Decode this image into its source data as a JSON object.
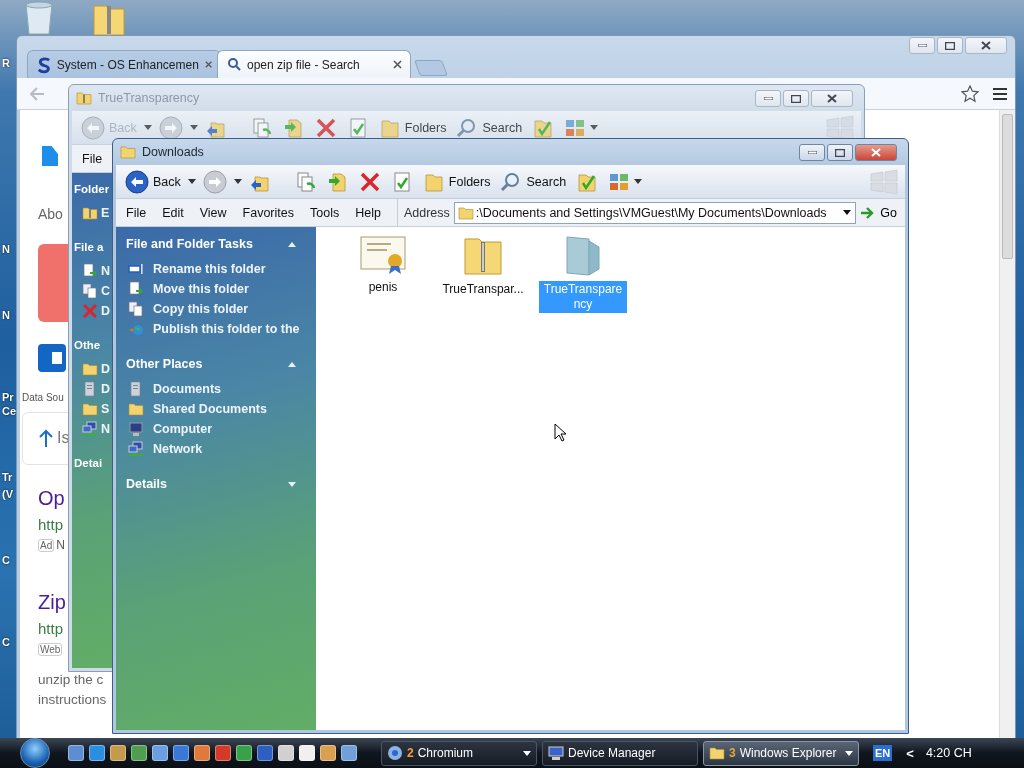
{
  "desktop": {
    "edge_labels": [
      "R",
      "N",
      "N",
      "Pr",
      "Ce",
      "Tr",
      "(V",
      "C",
      "C"
    ]
  },
  "browser": {
    "tabs": [
      {
        "label": "System - OS Enhancemen",
        "selected": false
      },
      {
        "label": "open zip file - Search",
        "selected": true
      }
    ],
    "about": "Abo",
    "data_source": "Data Sou",
    "answer": "Is",
    "results": [
      {
        "title": "Op",
        "url": "http",
        "badge": "Ad",
        "meta": "N"
      },
      {
        "title": "Zip",
        "url": "http",
        "badge": "Web",
        "snippet": [
          "unzip the c",
          "instructions"
        ]
      }
    ]
  },
  "back_window": {
    "title": "TrueTransparency",
    "toolbar": {
      "back": {
        "label": "Back",
        "disabled": true
      },
      "folders": "Folders",
      "search": "Search"
    },
    "menu": [
      "File"
    ],
    "sidebar": [
      {
        "title": "Folder",
        "items": [
          {
            "label": "E",
            "kind": "zip"
          }
        ]
      },
      {
        "title": "File a",
        "items": [
          {
            "label": "N",
            "kind": "move"
          },
          {
            "label": "C",
            "kind": "copy"
          },
          {
            "label": "D",
            "kind": "delete"
          }
        ]
      },
      {
        "title": "Othe",
        "items": [
          {
            "label": "D",
            "kind": "folder"
          },
          {
            "label": "D",
            "kind": "documents"
          },
          {
            "label": "S",
            "kind": "folder"
          },
          {
            "label": "N",
            "kind": "network"
          }
        ]
      },
      {
        "title": "Detai"
      }
    ]
  },
  "explorer": {
    "title": "Downloads",
    "toolbar": {
      "back": {
        "label": "Back",
        "disabled": false
      },
      "folders": "Folders",
      "search": "Search"
    },
    "menu": [
      "File",
      "Edit",
      "View",
      "Favorites",
      "Tools",
      "Help"
    ],
    "address": {
      "label": "Address",
      "value": ":\\Documents and Settings\\VMGuest\\My Documents\\Downloads",
      "go": "Go"
    },
    "sidebar": [
      {
        "title": "File and Folder Tasks",
        "expanded": true,
        "items": [
          {
            "label": "Rename this folder",
            "kind": "rename"
          },
          {
            "label": "Move this folder",
            "kind": "move"
          },
          {
            "label": "Copy this folder",
            "kind": "copy"
          },
          {
            "label": "Publish this folder to the",
            "kind": "publish"
          }
        ]
      },
      {
        "title": "Other Places",
        "expanded": true,
        "items": [
          {
            "label": "Documents",
            "kind": "documents"
          },
          {
            "label": "Shared Documents",
            "kind": "folder"
          },
          {
            "label": "Computer",
            "kind": "computer"
          },
          {
            "label": "Network",
            "kind": "network"
          }
        ]
      },
      {
        "title": "Details",
        "expanded": false
      }
    ],
    "files": [
      {
        "name": "penis",
        "kind": "certificate",
        "selected": false
      },
      {
        "name": "TrueTranspar...",
        "kind": "zip",
        "selected": false
      },
      {
        "name": "TrueTransparency",
        "kind": "folder",
        "selected": true
      }
    ]
  },
  "taskbar": {
    "tasks": [
      {
        "count": "2",
        "label": "Chromium",
        "kind": "chromium",
        "selected": false
      },
      {
        "label": "Device Manager",
        "kind": "device",
        "selected": false
      },
      {
        "count": "3",
        "label": "Windows Explorer",
        "kind": "folder",
        "selected": true
      }
    ],
    "language": "EN",
    "chevron": "<",
    "clock": "4:20 CH"
  }
}
